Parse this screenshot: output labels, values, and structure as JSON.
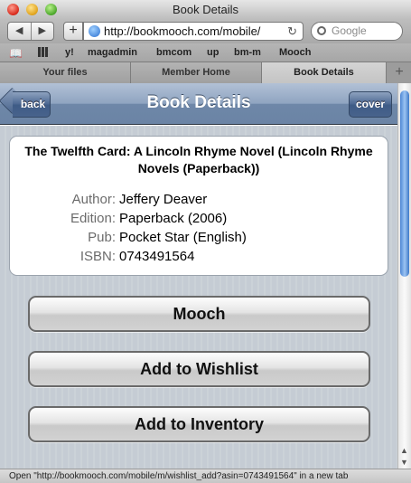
{
  "window": {
    "title": "Book Details"
  },
  "toolbar": {
    "back_glyph": "◀",
    "forward_glyph": "▶",
    "add_glyph": "+",
    "url": "http://bookmooch.com/mobile/",
    "reload_glyph": "↻",
    "search_placeholder": "Google"
  },
  "bookmarks": [
    "y!",
    "magadmin",
    "bmcom",
    "up",
    "bm-m",
    "Mooch"
  ],
  "tabs": [
    {
      "label": "Your files",
      "active": false
    },
    {
      "label": "Member Home",
      "active": false
    },
    {
      "label": "Book Details",
      "active": true
    }
  ],
  "new_tab_glyph": "+",
  "navbar": {
    "title": "Book Details",
    "back_label": "back",
    "cover_label": "cover",
    "colors": {
      "bar": "#8fa4c0",
      "button": "#4a6690"
    }
  },
  "book": {
    "title": "The Twelfth Card: A Lincoln Rhyme Novel (Lincoln Rhyme Novels (Paperback))",
    "details": [
      {
        "label": "Author:",
        "value": "Jeffery Deaver"
      },
      {
        "label": "Edition:",
        "value": "Paperback (2006)"
      },
      {
        "label": "Pub:",
        "value": "Pocket Star (English)"
      },
      {
        "label": "ISBN:",
        "value": "0743491564"
      }
    ]
  },
  "actions": {
    "mooch": "Mooch",
    "wishlist": "Add to Wishlist",
    "inventory": "Add to Inventory"
  },
  "statusbar": {
    "text": "Open \"http://bookmooch.com/mobile/m/wishlist_add?asin=0743491564\" in a new tab"
  }
}
